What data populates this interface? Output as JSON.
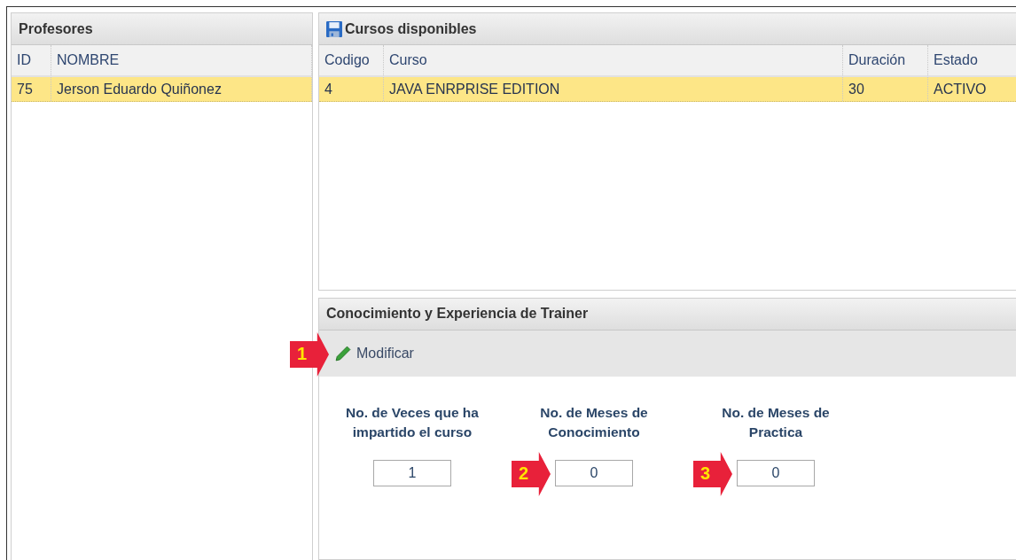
{
  "professors_panel": {
    "title": "Profesores",
    "columns": [
      "ID",
      "NOMBRE"
    ],
    "rows": [
      {
        "cells": [
          "75",
          "Jerson Eduardo Quiñonez"
        ],
        "selected": true
      }
    ]
  },
  "courses_panel": {
    "title": "Cursos disponibles",
    "columns": [
      "Codigo",
      "Curso",
      "Duración",
      "Estado"
    ],
    "rows": [
      {
        "cells": [
          "4",
          "JAVA ENRPRISE EDITION",
          "30",
          "ACTIVO"
        ],
        "selected": true
      }
    ]
  },
  "trainer_panel": {
    "title": "Conocimiento y Experiencia de Trainer",
    "toolbar_button": "Modificar",
    "toolbar_callout": "1",
    "fields": [
      {
        "label": "No. de Veces que ha impartido el curso",
        "value": "1"
      },
      {
        "label": "No. de Meses de Conocimiento",
        "value": "0",
        "callout": "2"
      },
      {
        "label": "No. de Meses de Practica",
        "value": "0",
        "callout": "3"
      }
    ]
  }
}
